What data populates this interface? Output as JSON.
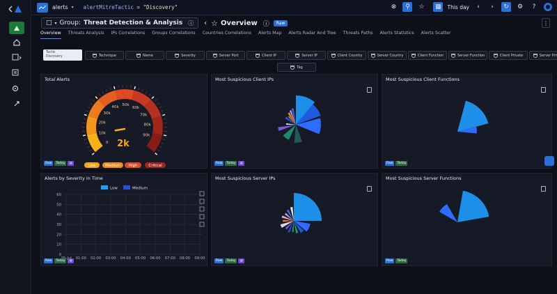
{
  "topbar": {
    "datasource": "alerts",
    "query_field": "alertMitreTactic",
    "query_op": "=",
    "query_value": "\"Discovery\"",
    "time_range": "This day"
  },
  "header": {
    "group_label": "Group:",
    "group_name": "Threat Detection & Analysis",
    "dashboard_title": "Overview",
    "raw_badge": "Raw"
  },
  "tabs": [
    "Overview",
    "Threats Analysis",
    "IPs Correlations",
    "Groups Correlations",
    "Countries Correlations",
    "Alerts Map",
    "Alerts Radar And Tree",
    "Threats Paths",
    "Alerts Statistics",
    "Alerts Scatter"
  ],
  "filters": {
    "active_chip_line1": "Tactic",
    "active_chip_line2": "Discovery",
    "chips": [
      "Technique",
      "Name",
      "Severity",
      "Server Port",
      "Client IP",
      "Server IP",
      "Client Country",
      "Server Country",
      "Client Function",
      "Server Function",
      "Client Private",
      "Server Private",
      "Tag"
    ]
  },
  "panels": {
    "total_alerts": {
      "title": "Total Alerts",
      "value": "2k",
      "gauge_ticks": [
        "0",
        "10k",
        "20k",
        "30k",
        "40k",
        "50k",
        "60k",
        "70k",
        "80k",
        "90k"
      ],
      "legend": [
        "Low",
        "Medium",
        "High",
        "Critical"
      ],
      "tags": [
        "Raw",
        "Today",
        "@"
      ]
    },
    "client_ips": {
      "title": "Most Suspicious Client IPs",
      "tags": [
        "Raw",
        "Today",
        "@"
      ]
    },
    "client_functions": {
      "title": "Most Suspicious Client Functions",
      "tags": [
        "Raw",
        "Today"
      ]
    },
    "severity_time": {
      "title": "Alerts by Severity in Time",
      "tags": [
        "Raw",
        "Today",
        "@"
      ]
    },
    "server_ips": {
      "title": "Most Suspicious Server IPs",
      "tags": [
        "Raw",
        "Today",
        "@"
      ]
    },
    "server_functions": {
      "title": "Most Suspicious Server Functions",
      "tags": [
        "Raw",
        "Today"
      ]
    }
  },
  "colors": {
    "low": "#1da1f2",
    "medium": "#2b4fd8",
    "high": "#e05a2b",
    "critical": "#a01414"
  },
  "chart_data": {
    "type": "line",
    "title": "Alerts by Severity in Time",
    "series": [
      {
        "name": "Low",
        "values": []
      },
      {
        "name": "Medium",
        "values": []
      }
    ],
    "x": [
      "26-Jul",
      "01:00",
      "02:00",
      "03:00",
      "04:00",
      "05:00",
      "06:00",
      "07:00",
      "08:00",
      "09:00"
    ],
    "ylim": [
      0,
      60
    ],
    "yticks": [
      0,
      10,
      20,
      30,
      40,
      50,
      60
    ],
    "grid": true,
    "legend_position": "top"
  }
}
